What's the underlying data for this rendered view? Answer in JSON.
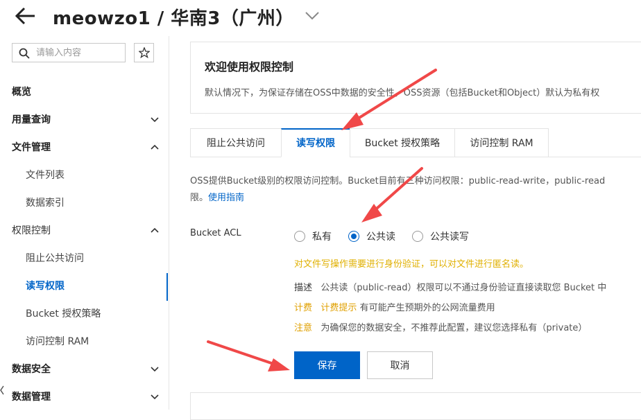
{
  "header": {
    "title": "meowzo1 / 华南3（广州）"
  },
  "sidebar": {
    "search_placeholder": "请输入内容",
    "items": [
      {
        "label": "概览"
      },
      {
        "label": "用量查询"
      },
      {
        "label": "文件管理"
      },
      {
        "label": "文件列表"
      },
      {
        "label": "数据索引"
      },
      {
        "label": "权限控制"
      },
      {
        "label": "阻止公共访问"
      },
      {
        "label": "读写权限"
      },
      {
        "label": "Bucket 授权策略"
      },
      {
        "label": "访问控制 RAM"
      },
      {
        "label": "数据安全"
      },
      {
        "label": "数据管理"
      }
    ]
  },
  "welcome": {
    "title": "欢迎使用权限控制",
    "text": "默认情况下，为保证存储在OSS中数据的安全性，OSS资源（包括Bucket和Object）默认为私有权"
  },
  "tabs": [
    {
      "label": "阻止公共访问"
    },
    {
      "label": "读写权限"
    },
    {
      "label": "Bucket 授权策略"
    },
    {
      "label": "访问控制 RAM"
    }
  ],
  "description": {
    "line1": "OSS提供Bucket级别的权限访问控制。Bucket目前有三种访问权限：public-read-write，public-read",
    "line2_prefix": "限。",
    "guide_link": "使用指南"
  },
  "acl": {
    "label": "Bucket ACL",
    "options": [
      {
        "label": "私有"
      },
      {
        "label": "公共读"
      },
      {
        "label": "公共读写"
      }
    ],
    "selected": "公共读",
    "warning": "对文件写操作需要进行身份验证，可以对文件进行匿名读。",
    "desc_key": "描述",
    "desc_text": "公共读（public-read）权限可以不通过身份验证直接读取您 Bucket 中",
    "billing_key": "计费",
    "billing_highlight": "计费提示",
    "billing_text": "有可能产生预期外的公网流量费用",
    "note_key": "注意",
    "note_text": "为确保您的数据安全，不推荐此配置，建议您选择私有（private）"
  },
  "buttons": {
    "save": "保存",
    "cancel": "取消"
  },
  "colors": {
    "accent": "#0064c8",
    "warning": "#e0b000",
    "annotation_arrow": "#f04848"
  }
}
